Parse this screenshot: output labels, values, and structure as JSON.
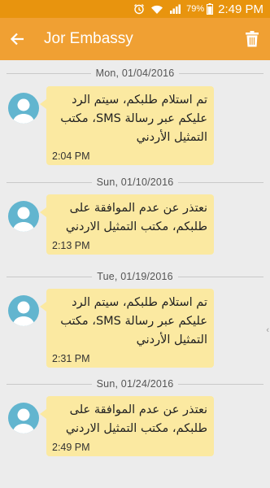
{
  "status_bar": {
    "battery_percent": "79%",
    "time": "2:49 PM"
  },
  "app_bar": {
    "title": "Jor Embassy",
    "back_icon": "arrow-back-icon",
    "delete_icon": "trash-icon"
  },
  "colors": {
    "status_bar": "#e8940e",
    "app_bar": "#f0a033",
    "bubble": "#fbe9a1",
    "avatar": "#62b5cf",
    "background": "#ececec"
  },
  "conversation": [
    {
      "date": "Mon, 01/04/2016",
      "text": "تم استلام طلبكم، سيتم الرد عليكم عبر رسالة SMS، مكتب التمثيل الأردني",
      "time": "2:04 PM"
    },
    {
      "date": "Sun, 01/10/2016",
      "text": "نعتذر عن عدم الموافقة على طلبكم، مكتب التمثيل الاردني",
      "time": "2:13 PM"
    },
    {
      "date": "Tue, 01/19/2016",
      "text": "تم استلام طلبكم، سيتم الرد عليكم عبر رسالة SMS، مكتب التمثيل الأردني",
      "time": "2:31 PM"
    },
    {
      "date": "Sun, 01/24/2016",
      "text": "نعتذر عن عدم الموافقة على طلبكم، مكتب التمثيل الاردني",
      "time": "2:49 PM"
    }
  ]
}
